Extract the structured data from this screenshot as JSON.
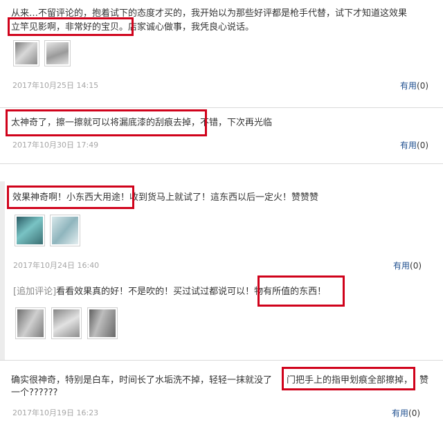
{
  "reviews": [
    {
      "line1": "从来…不留评论的，抱着试下的态度才买的，我开始以为那些好评都是枪手代替，试下才知道这效果",
      "line2_a": "立竿见影啊，非常好的宝贝。",
      "line2_b": "店家诚心做事，我凭良心说话。",
      "date": "2017年10月25日 14:15",
      "useful_label": "有用",
      "useful_count": "(0)"
    },
    {
      "text_a": "太神奇了，擦一擦就可以将漏底漆的刮痕去掉，",
      "text_b": "不错，下次再光临",
      "date": "2017年10月30日 17:49",
      "useful_label": "有用",
      "useful_count": "(0)"
    },
    {
      "text_a": "效果神奇啊！小东西大用途！",
      "text_b": "收到货马上就试了！這东西以后一定火！赞赞赞",
      "date": "2017年10月24日 16:40",
      "useful_label": "有用",
      "useful_count": "(0)",
      "followup_tag": "[追加评论]",
      "followup_a": "看看效果真的好！不是吹的！买过试过都说可以！",
      "followup_b": "物有所值的东西！"
    },
    {
      "line1_a": "确实很神奇，特别是白车，时间长了水垢洗不掉，轻轻一抹就没了",
      "line1_b": "门把手上的指甲划痕全部擦掉，",
      "line1_c": "赞",
      "line2": "一个??????",
      "date": "2017年10月19日 16:23",
      "useful_label": "有用",
      "useful_count": "(0)"
    }
  ],
  "colors": {
    "highlight": "#d0021b",
    "link": "#1f4f8f",
    "meta": "#a6a6a6"
  }
}
